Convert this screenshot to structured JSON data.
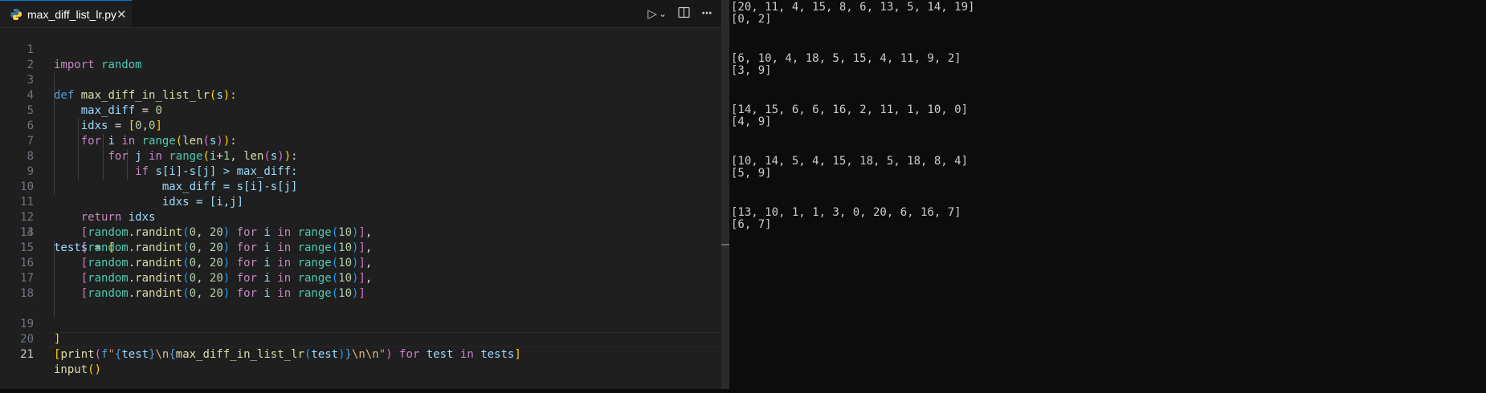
{
  "tab": {
    "filename": "max_diff_list_lr.py",
    "close_glyph": "✕"
  },
  "actions": {
    "run_glyph": "▷",
    "dropdown_glyph": "⌄",
    "split_glyph": "◫",
    "more_glyph": "···"
  },
  "line_numbers": [
    "1",
    "2",
    "3",
    "4",
    "5",
    "6",
    "7",
    "8",
    "9",
    "10",
    "11",
    "12",
    "13",
    "14",
    "15",
    "16",
    "17",
    "18",
    "19",
    "20",
    "21"
  ],
  "code": {
    "l1": {
      "kw": "import",
      "mod": "random"
    },
    "l3": {
      "kw": "def",
      "fn": "max_diff_in_list_lr",
      "p1": "(",
      "arg": "s",
      "p2": "):"
    },
    "l4": {
      "var": "max_diff",
      "eq": " = ",
      "num": "0"
    },
    "l5": {
      "var": "idxs",
      "eq": " = ",
      "b1": "[",
      "n1": "0",
      "c": ",",
      "n2": "0",
      "b2": "]"
    },
    "l6": {
      "k1": "for",
      "v1": "i",
      "k2": "in",
      "f1": "range",
      "p1": "(",
      "f2": "len",
      "p2": "(",
      "v2": "s",
      "p3": "))",
      "colon": ":"
    },
    "l7": {
      "k1": "for",
      "v1": "j",
      "k2": "in",
      "f1": "range",
      "p1": "(",
      "v2": "i",
      "op": "+",
      "n1": "1",
      "c": ", ",
      "f2": "len",
      "p2": "(",
      "v3": "s",
      "p3": "))",
      "colon": ":"
    },
    "l8": {
      "k1": "if",
      "text": "s[i]-s[j] > max_diff:"
    },
    "l9": {
      "text": "max_diff = s[i]-s[j]"
    },
    "l10": {
      "text": "idxs = [i,j]"
    },
    "l11": {
      "k1": "return",
      "v1": "idxs"
    },
    "l13": {
      "var": "tests",
      "eq": " = ",
      "b": "["
    },
    "list_item": {
      "b1": "[",
      "mod": "random",
      "dot": ".",
      "fn": "randint",
      "p1": "(",
      "n1": "0",
      "c": ", ",
      "n2": "20",
      "p2": ")",
      "k1": "for",
      "v1": "i",
      "k2": "in",
      "fn2": "range",
      "p3": "(",
      "n3": "10",
      "p4": ")",
      "b2": "]",
      "comma": ","
    },
    "l19": {
      "b": "]"
    },
    "l20": {
      "b1": "[",
      "fn": "print",
      "p1": "(",
      "pre": "f",
      "q1": "\"",
      "br1": "{",
      "v1": "test",
      "br2": "}",
      "esc1": "\\n",
      "br3": "{",
      "fn2": "max_diff_in_list_lr",
      "p2": "(",
      "v2": "test",
      "p3": ")",
      "br4": "}",
      "esc2": "\\n\\n",
      "q2": "\"",
      "p4": ")",
      "k1": "for",
      "v3": "test",
      "k2": "in",
      "v4": "tests",
      "b2": "]"
    },
    "l21": {
      "fn": "input",
      "p": "()"
    }
  },
  "terminal": {
    "lines": [
      "[20, 11, 4, 15, 8, 6, 13, 5, 14, 19]",
      "[0, 2]",
      "[6, 10, 4, 18, 5, 15, 4, 11, 9, 2]",
      "[3, 9]",
      "[14, 15, 6, 6, 16, 2, 11, 1, 10, 0]",
      "[4, 9]",
      "[10, 14, 5, 4, 15, 18, 5, 18, 8, 4]",
      "[5, 9]",
      "[13, 10, 1, 1, 3, 0, 20, 6, 16, 7]",
      "[6, 7]"
    ]
  },
  "colors": {
    "editor_bg": "#1f1f1f",
    "terminal_bg": "#0c0c0c",
    "tab_accent": "#0078d4",
    "python_blue": "#3572a5",
    "python_yellow": "#ffd43b"
  }
}
